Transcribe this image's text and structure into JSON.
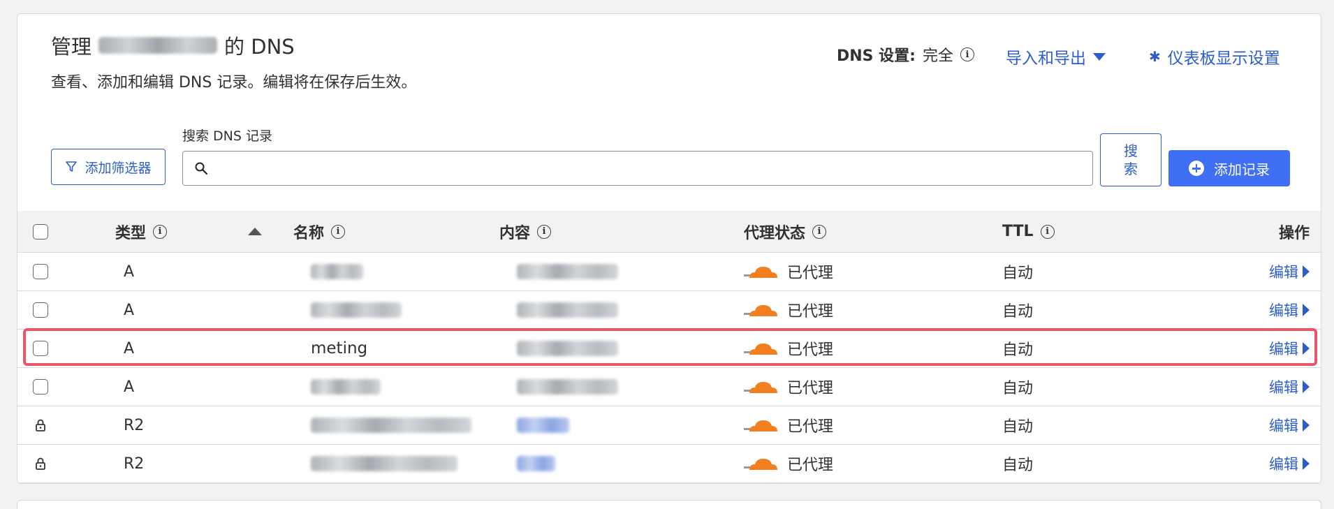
{
  "header": {
    "title_prefix": "管理",
    "title_suffix": "的 DNS",
    "subtitle": "查看、添加和编辑 DNS 记录。编辑将在保存后生效。",
    "dns_setting_label": "DNS 设置:",
    "dns_setting_value": "完全",
    "import_export": "导入和导出",
    "dashboard_settings": "仪表板显示设置"
  },
  "toolbar": {
    "filter_label": "添加筛选器",
    "search_label": "搜索 DNS 记录",
    "search_value": "",
    "search_button": "搜\n索",
    "add_record": "添加记录"
  },
  "table": {
    "columns": {
      "type": "类型",
      "name": "名称",
      "content": "内容",
      "proxy": "代理状态",
      "ttl": "TTL",
      "action": "操作"
    },
    "rows": [
      {
        "type": "A",
        "name": "",
        "content": "",
        "proxy": "已代理",
        "ttl": "自动",
        "action": "编辑",
        "locked": false
      },
      {
        "type": "A",
        "name": "",
        "content": "",
        "proxy": "已代理",
        "ttl": "自动",
        "action": "编辑",
        "locked": false
      },
      {
        "type": "A",
        "name": "meting",
        "content": "",
        "proxy": "已代理",
        "ttl": "自动",
        "action": "编辑",
        "locked": false
      },
      {
        "type": "A",
        "name": "",
        "content": "",
        "proxy": "已代理",
        "ttl": "自动",
        "action": "编辑",
        "locked": false
      },
      {
        "type": "R2",
        "name": "",
        "content": "",
        "proxy": "已代理",
        "ttl": "自动",
        "action": "编辑",
        "locked": true
      },
      {
        "type": "R2",
        "name": "",
        "content": "",
        "proxy": "已代理",
        "ttl": "自动",
        "action": "编辑",
        "locked": true
      }
    ]
  },
  "colors": {
    "accent": "#2c5ec9",
    "primary_button": "#3e6ff4",
    "cloud": "#f38020",
    "highlight": "#ec5569"
  }
}
